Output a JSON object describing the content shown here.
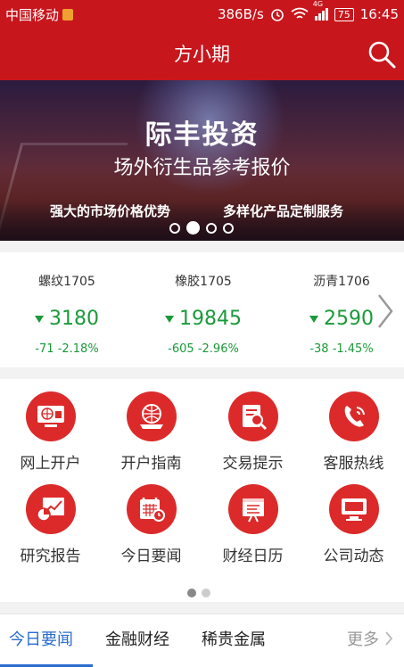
{
  "status_bar": {
    "carrier": "中国移动",
    "speed": "386B/s",
    "network": "4G",
    "battery": "75",
    "time": "16:45"
  },
  "header": {
    "title": "方小期"
  },
  "banner": {
    "title": "际丰投资",
    "subtitle": "场外衍生品参考报价",
    "slogan_left": "强大的市场价格优势",
    "slogan_right": "多样化产品定制服务",
    "slide_count": 4,
    "active_slide": 2
  },
  "quotes": [
    {
      "name": "螺纹1705",
      "price": "3180",
      "change": "-71",
      "pct": "-2.18%",
      "direction": "down"
    },
    {
      "name": "橡胶1705",
      "price": "19845",
      "change": "-605",
      "pct": "-2.96%",
      "direction": "down"
    },
    {
      "name": "沥青1706",
      "price": "2590",
      "change": "-38",
      "pct": "-1.45%",
      "direction": "down"
    }
  ],
  "menu": [
    {
      "label": "网上开户",
      "icon": "online-account-icon"
    },
    {
      "label": "开户指南",
      "icon": "account-guide-icon"
    },
    {
      "label": "交易提示",
      "icon": "trade-tips-icon"
    },
    {
      "label": "客服热线",
      "icon": "service-hotline-icon"
    },
    {
      "label": "研究报告",
      "icon": "research-report-icon"
    },
    {
      "label": "今日要闻",
      "icon": "today-news-icon"
    },
    {
      "label": "财经日历",
      "icon": "finance-calendar-icon"
    },
    {
      "label": "公司动态",
      "icon": "company-news-icon"
    }
  ],
  "tabs": [
    {
      "label": "今日要闻",
      "active": true
    },
    {
      "label": "金融财经",
      "active": false
    },
    {
      "label": "稀贵金属",
      "active": false
    }
  ],
  "more_label": "更多",
  "colors": {
    "brand_red": "#c8161d",
    "icon_red": "#dc2a2a",
    "down_green": "#1a9a3a",
    "tab_blue": "#2a6dd0"
  }
}
